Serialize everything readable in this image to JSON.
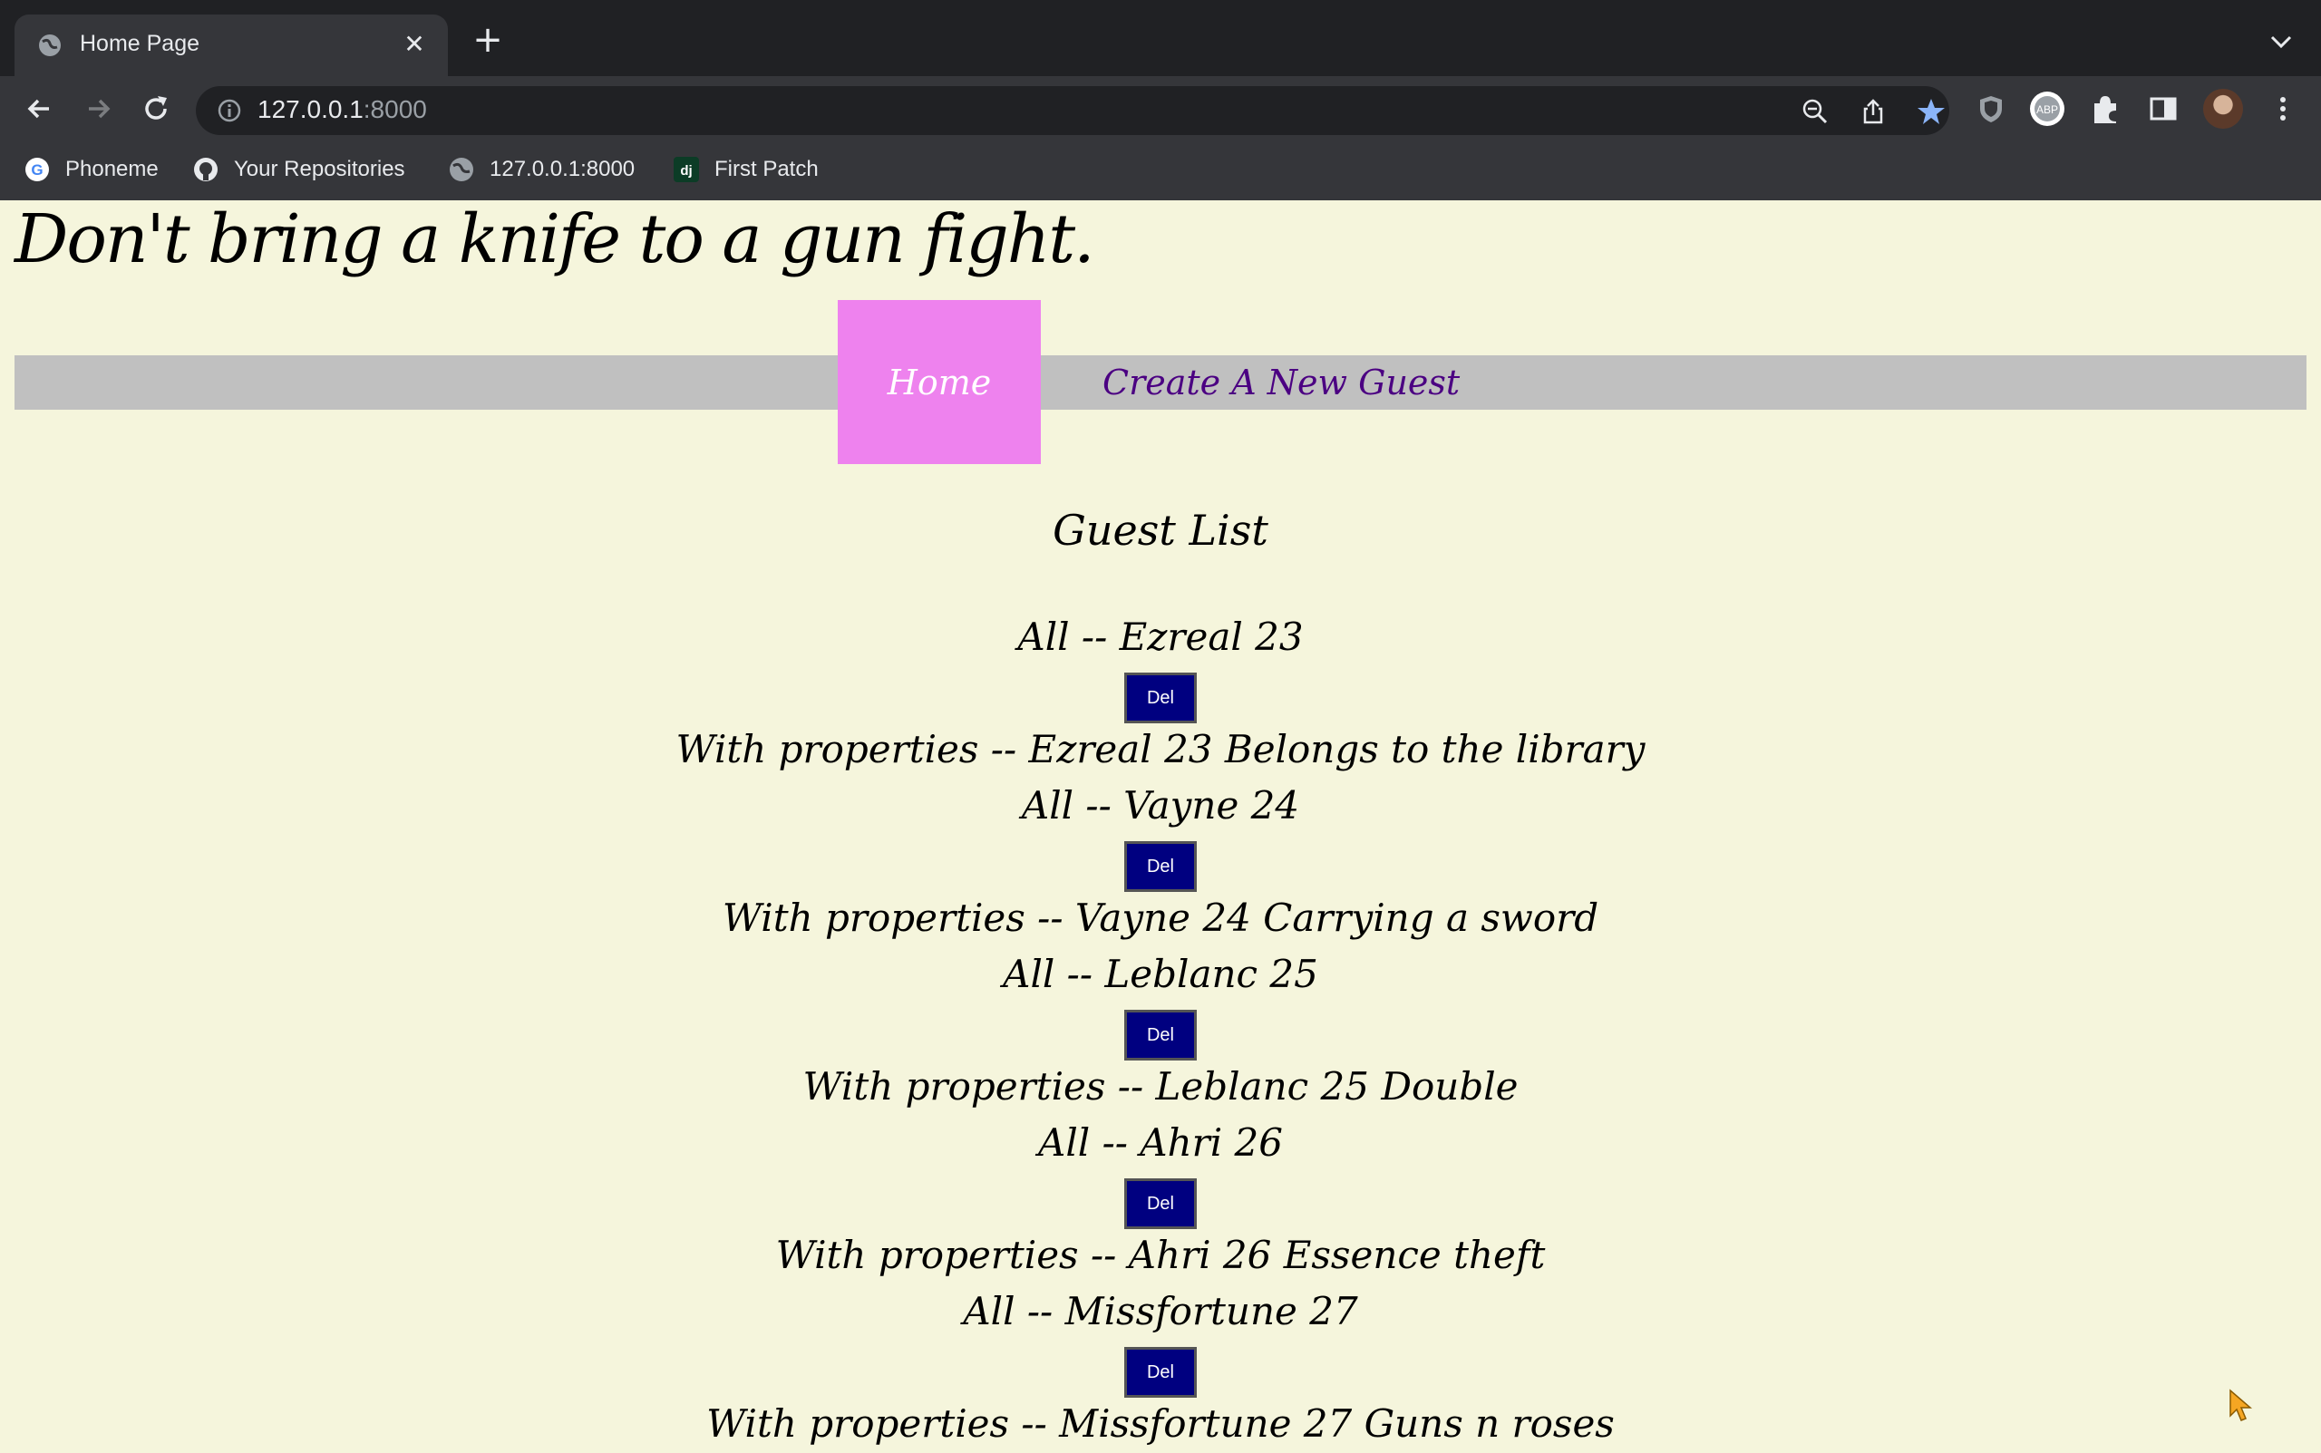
{
  "browser": {
    "tab_title": "Home Page",
    "tab_close": "✕",
    "new_tab": "+",
    "url_host": "127.0.0.1",
    "url_port": ":8000",
    "bookmarks": [
      {
        "label": "Phoneme",
        "icon": "google-icon"
      },
      {
        "label": "Your Repositories",
        "icon": "github-icon"
      },
      {
        "label": "127.0.0.1:8000",
        "icon": "globe-icon"
      },
      {
        "label": "First Patch",
        "icon": "django-icon"
      }
    ]
  },
  "page": {
    "headline": "Don't bring a knife to a gun fight.",
    "nav": {
      "home": "Home",
      "create": "Create A New Guest"
    },
    "list_title": "Guest List",
    "del_label": "Del",
    "guests": [
      {
        "all": "All -- Ezreal 23",
        "props": "With properties -- Ezreal 23 Belongs to the library"
      },
      {
        "all": "All -- Vayne 24",
        "props": "With properties -- Vayne 24 Carrying a sword"
      },
      {
        "all": "All -- Leblanc 25",
        "props": "With properties -- Leblanc 25 Double"
      },
      {
        "all": "All -- Ahri 26",
        "props": "With properties -- Ahri 26 Essence theft"
      },
      {
        "all": "All -- Missfortune 27",
        "props": "With properties -- Missfortune 27 Guns n roses"
      }
    ]
  },
  "colors": {
    "page_bg": "#f5f5dc",
    "nav_bar": "#c0c0c0",
    "home_bg": "#ee82ee",
    "create_link": "#4b0082",
    "del_button": "#000080"
  }
}
